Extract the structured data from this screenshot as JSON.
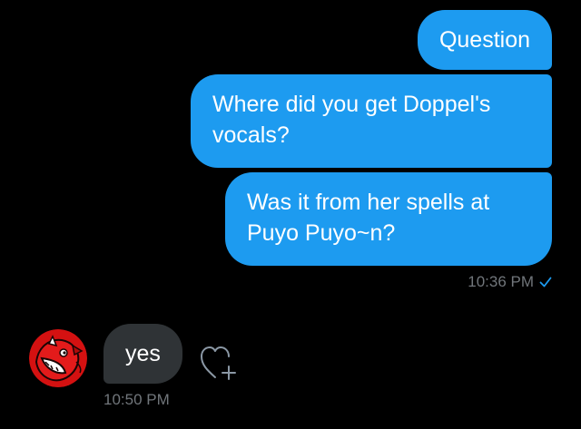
{
  "conversation": {
    "sent_messages": [
      {
        "text": "Question"
      },
      {
        "text": "Where did you get Doppel's vocals?"
      },
      {
        "text": "Was it from her spells at Puyo Puyo~n?"
      }
    ],
    "sent_timestamp": "10:36 PM",
    "sent_status_icon": "checkmark-icon",
    "received_message": {
      "text": "yes",
      "timestamp": "10:50 PM",
      "avatar": "red-creature-avatar"
    },
    "reaction_icon": "add-reaction-heart-icon"
  },
  "colors": {
    "background": "#000000",
    "sent_bubble": "#1d9bf0",
    "received_bubble": "#2f3336",
    "timestamp": "#71767b",
    "accent": "#1d9bf0"
  }
}
